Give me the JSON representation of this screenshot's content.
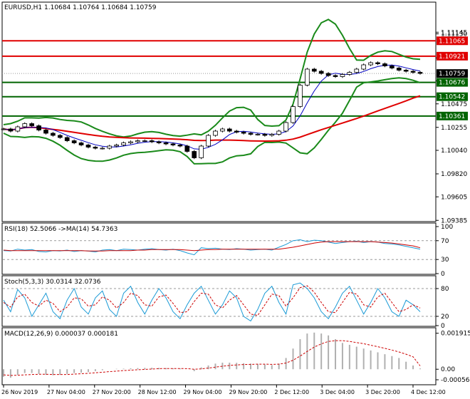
{
  "header": {
    "symbol_tf": "EURUSD,H1",
    "ohlc": "1.10684 1.10764 1.10684 1.10759"
  },
  "colors": {
    "level_line": "#e00000",
    "support_line": "#006400",
    "ma_slow": "#e00000",
    "ma_fast": "#0000c0",
    "bollinger": "#1a8a1a",
    "price_line": "#000000",
    "rsi": "#1a9ad6",
    "rsi_ma": "#cc0000",
    "stoch_main": "#1a9ad6",
    "stoch_signal": "#cc0000",
    "macd_hist": "#b0b0b0",
    "macd_signal": "#cc0000"
  },
  "chart_data": [
    {
      "type": "candlestick",
      "title": "EURUSD,H1",
      "ylim": [
        1.0938,
        1.1142
      ],
      "y_ticks": [
        "1.11145",
        "1.11130",
        "1.10905",
        "1.10690",
        "1.10475",
        "1.10255",
        "1.10040",
        "1.09820",
        "1.09605",
        "1.09385"
      ],
      "x_labels": [
        "26 Nov 2019",
        "27 Nov 04:00",
        "27 Nov 20:00",
        "28 Nov 12:00",
        "29 Nov 04:00",
        "29 Nov 20:00",
        "2 Dec 12:00",
        "3 Dec 04:00",
        "3 Dec 20:00",
        "4 Dec 12:00"
      ],
      "levels": [
        {
          "value": 1.11065,
          "label": "1.11065",
          "kind": "resistance"
        },
        {
          "value": 1.10921,
          "label": "1.10921",
          "kind": "resistance"
        },
        {
          "value": 1.10676,
          "label": "1.10676",
          "kind": "support"
        },
        {
          "value": 1.10542,
          "label": "1.10542",
          "kind": "support"
        },
        {
          "value": 1.10361,
          "label": "1.10361",
          "kind": "support"
        }
      ],
      "current_price": {
        "value": 1.10759,
        "label": "1.10759"
      },
      "series": [
        {
          "values": [
            1.1024,
            1.1022,
            1.1026,
            1.1029,
            1.1027,
            1.1023,
            1.102,
            1.1018,
            1.1016,
            1.1013,
            1.1011,
            1.1009,
            1.1007,
            1.1006,
            1.1006,
            1.1008,
            1.1009,
            1.1011,
            1.1012,
            1.1013,
            1.1013,
            1.1012,
            1.1011,
            1.101,
            1.1009,
            1.1008,
            1.1003,
            1.0997,
            1.1008,
            1.1018,
            1.1022,
            1.1024,
            1.1022,
            1.1021,
            1.102,
            1.1019,
            1.1019,
            1.1018,
            1.1019,
            1.1022,
            1.103,
            1.1045,
            1.1065,
            1.108,
            1.1078,
            1.1076,
            1.1074,
            1.1073,
            1.1075,
            1.1077,
            1.108,
            1.1084,
            1.1086,
            1.1085,
            1.1083,
            1.1081,
            1.1079,
            1.1078,
            1.1077,
            1.1076
          ]
        }
      ]
    },
    {
      "type": "line",
      "title": "RSI(18) 52.5066 ->MA(14) 54.7363",
      "ylim": [
        0,
        100
      ],
      "y_ticks": [
        "100",
        "70",
        "30",
        "0"
      ],
      "levels": [
        70,
        30
      ],
      "series": [
        {
          "values": [
            49,
            48,
            52,
            50,
            51,
            47,
            46,
            49,
            48,
            50,
            47,
            49,
            48,
            46,
            50,
            51,
            49,
            52,
            51,
            50,
            52,
            53,
            51,
            50,
            52,
            49,
            44,
            40,
            55,
            53,
            54,
            52,
            51,
            53,
            52,
            50,
            51,
            52,
            50,
            56,
            62,
            70,
            72,
            68,
            71,
            70,
            67,
            64,
            66,
            68,
            69,
            66,
            68,
            67,
            64,
            63,
            61,
            58,
            55,
            52
          ]
        },
        {
          "values": [
            50,
            49,
            49,
            49,
            49,
            49,
            49,
            49,
            49,
            49,
            49,
            49,
            48,
            48,
            48,
            49,
            49,
            49,
            49,
            50,
            50,
            51,
            51,
            51,
            51,
            51,
            50,
            49,
            50,
            51,
            51,
            52,
            52,
            52,
            52,
            52,
            52,
            52,
            52,
            52,
            54,
            56,
            59,
            62,
            65,
            67,
            68,
            68,
            68,
            68,
            68,
            68,
            68,
            67,
            66,
            65,
            63,
            61,
            59,
            55
          ]
        }
      ]
    },
    {
      "type": "line",
      "title": "Stoch(5,3,3) 30.0314 32.0736",
      "ylim": [
        0,
        100
      ],
      "y_ticks": [
        "80",
        "20",
        "0"
      ],
      "levels": [
        80,
        20
      ],
      "series": [
        {
          "values": [
            55,
            30,
            78,
            60,
            20,
            45,
            70,
            30,
            15,
            55,
            80,
            40,
            25,
            60,
            75,
            35,
            20,
            70,
            85,
            50,
            25,
            55,
            80,
            60,
            30,
            15,
            45,
            70,
            85,
            55,
            25,
            45,
            75,
            60,
            20,
            10,
            35,
            70,
            85,
            50,
            25,
            88,
            92,
            80,
            60,
            30,
            15,
            40,
            70,
            85,
            55,
            25,
            50,
            80,
            60,
            30,
            20,
            55,
            45,
            30
          ]
        },
        {
          "values": [
            50,
            40,
            62,
            68,
            50,
            42,
            55,
            48,
            30,
            40,
            60,
            58,
            42,
            45,
            62,
            55,
            38,
            50,
            70,
            65,
            45,
            42,
            62,
            66,
            48,
            28,
            30,
            52,
            70,
            68,
            45,
            38,
            55,
            65,
            45,
            25,
            22,
            45,
            68,
            65,
            42,
            60,
            82,
            86,
            72,
            50,
            30,
            28,
            50,
            72,
            68,
            45,
            40,
            62,
            70,
            50,
            30,
            35,
            45,
            38
          ]
        }
      ]
    },
    {
      "type": "bar",
      "title": "MACD(12,26,9) 0.000037 0.000181",
      "ylim": [
        -0.00075,
        0.00198
      ],
      "y_ticks": [
        "0.001915",
        "0.00",
        "-0.00056"
      ],
      "series": [
        {
          "values": [
            -0.0004,
            -0.00045,
            -0.0003,
            -0.0002,
            -0.0002,
            -0.00025,
            -0.0003,
            -0.00032,
            -0.0003,
            -0.00025,
            -0.0002,
            -0.00018,
            -0.00015,
            -0.0001,
            -5e-05,
            0.0,
            2e-05,
            3e-05,
            5e-05,
            6e-05,
            7e-05,
            8e-05,
            7e-05,
            6e-05,
            5e-05,
            4e-05,
            0.0,
            -0.0001,
            0.0001,
            0.0002,
            0.0003,
            0.00035,
            0.00035,
            0.00034,
            0.00032,
            0.0003,
            0.00028,
            0.00025,
            0.00022,
            0.0003,
            0.0006,
            0.0011,
            0.0016,
            0.0019,
            0.00195,
            0.0019,
            0.0018,
            0.0016,
            0.0014,
            0.0013,
            0.0012,
            0.0011,
            0.001,
            0.0009,
            0.0008,
            0.0007,
            0.0006,
            0.0004,
            0.0002,
            4e-05
          ]
        },
        {
          "values": [
            -0.0003,
            -0.00033,
            -0.00032,
            -0.0003,
            -0.00028,
            -0.00027,
            -0.00027,
            -0.00028,
            -0.00028,
            -0.00028,
            -0.00026,
            -0.00024,
            -0.00022,
            -0.00019,
            -0.00016,
            -0.00013,
            -0.0001,
            -7e-05,
            -5e-05,
            -3e-05,
            -1e-05,
            1e-05,
            3e-05,
            4e-05,
            4e-05,
            4e-05,
            3e-05,
            0.0,
            2e-05,
            6e-05,
            0.00011,
            0.00016,
            0.0002,
            0.00023,
            0.00025,
            0.00026,
            0.00027,
            0.00027,
            0.00026,
            0.00027,
            0.00033,
            0.00048,
            0.0007,
            0.00095,
            0.00118,
            0.00135,
            0.00148,
            0.00152,
            0.00152,
            0.00148,
            0.00142,
            0.00136,
            0.00128,
            0.0012,
            0.00111,
            0.00102,
            0.00092,
            0.0008,
            0.00066,
            0.00018
          ]
        }
      ]
    }
  ]
}
